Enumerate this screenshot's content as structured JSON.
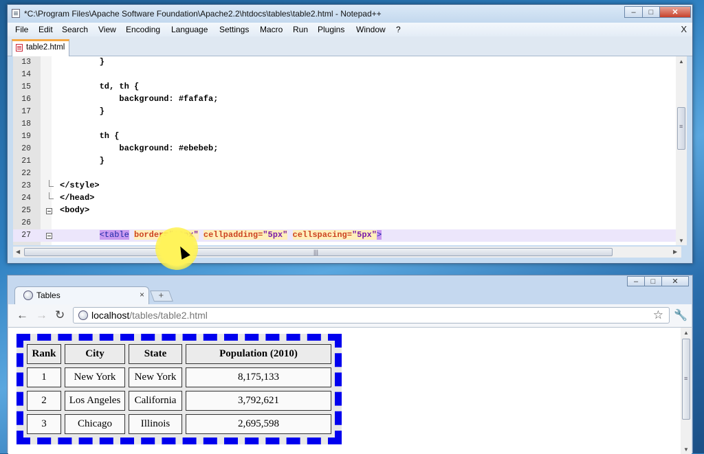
{
  "notepad": {
    "title": "*C:\\Program Files\\Apache Software Foundation\\Apache2.2\\htdocs\\tables\\table2.html - Notepad++",
    "window_buttons": [
      "–",
      "□",
      "✕"
    ],
    "menu": [
      "File",
      "Edit",
      "Search",
      "View",
      "Encoding",
      "Language",
      "Settings",
      "Macro",
      "Run",
      "Plugins",
      "Window",
      "?"
    ],
    "menu_close": "X",
    "tab": "table2.html",
    "lines": [
      {
        "n": "13",
        "text": "        }"
      },
      {
        "n": "14",
        "text": ""
      },
      {
        "n": "15",
        "text": "        td, th {"
      },
      {
        "n": "16",
        "text": "            background: #fafafa;"
      },
      {
        "n": "17",
        "text": "        }"
      },
      {
        "n": "18",
        "text": ""
      },
      {
        "n": "19",
        "text": "        th {"
      },
      {
        "n": "20",
        "text": "            background: #ebebeb;"
      },
      {
        "n": "21",
        "text": "        }"
      },
      {
        "n": "22",
        "text": ""
      },
      {
        "n": "23",
        "text": "</style>"
      },
      {
        "n": "24",
        "text": "</head>"
      },
      {
        "n": "25",
        "text": "<body>"
      },
      {
        "n": "26",
        "text": ""
      },
      {
        "n": "27",
        "text": ""
      }
    ],
    "line27": {
      "indent": "        ",
      "tag_open": "<table",
      "attr1": "border",
      "eq": "=",
      "val1": "\"10px\"",
      "attr2": "cellpadding",
      "val2": "\"5px\"",
      "attr3": "cellspacing",
      "val3": "\"5px\"",
      "tag_close": ">"
    },
    "scroll_grip": "≡",
    "hscroll_grip": "|||"
  },
  "browser": {
    "tab_title": "Tables",
    "tab_close": "×",
    "new_tab": "+",
    "back": "←",
    "forward": "→",
    "reload": "↻",
    "url_host": "localhost",
    "url_path": "/tables/table2.html",
    "bookmark": "☆",
    "menu_icon": "🔧",
    "window_buttons": [
      "–",
      "□",
      "✕"
    ],
    "scroll_grip": "≡",
    "table": {
      "headers": [
        "Rank",
        "City",
        "State",
        "Population (2010)"
      ],
      "rows": [
        [
          "1",
          "New York",
          "New York",
          "8,175,133"
        ],
        [
          "2",
          "Los Angeles",
          "California",
          "3,792,621"
        ],
        [
          "3",
          "Chicago",
          "Illinois",
          "2,695,598"
        ]
      ]
    }
  }
}
